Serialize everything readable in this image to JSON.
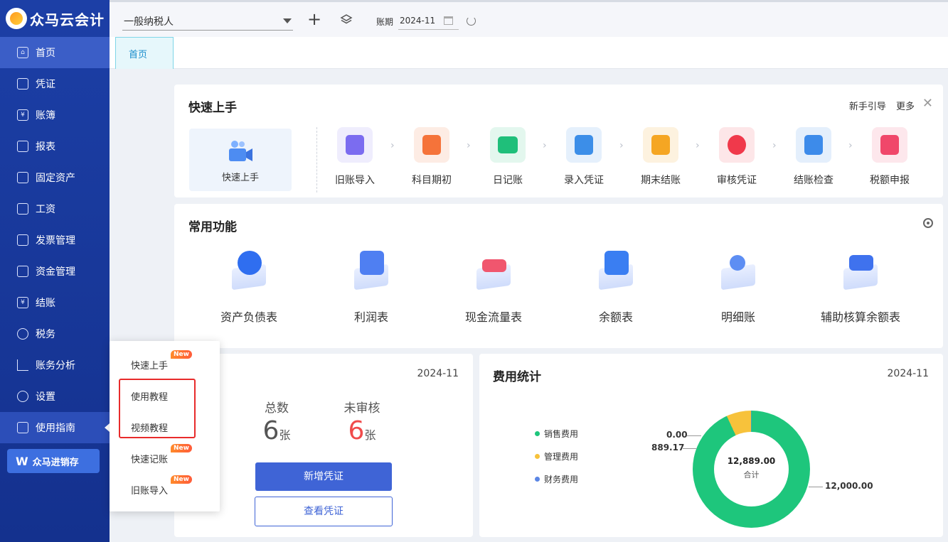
{
  "app": {
    "title": "众马云会计"
  },
  "sidebar": {
    "items": [
      {
        "label": "首页",
        "icon": "home-icon"
      },
      {
        "label": "凭证",
        "icon": "voucher-icon"
      },
      {
        "label": "账簿",
        "icon": "ledger-icon"
      },
      {
        "label": "报表",
        "icon": "report-icon"
      },
      {
        "label": "固定资产",
        "icon": "asset-icon"
      },
      {
        "label": "工资",
        "icon": "salary-icon"
      },
      {
        "label": "发票管理",
        "icon": "invoice-icon"
      },
      {
        "label": "资金管理",
        "icon": "fund-icon"
      },
      {
        "label": "结账",
        "icon": "closing-icon"
      },
      {
        "label": "税务",
        "icon": "tax-icon"
      },
      {
        "label": "账务分析",
        "icon": "analysis-icon"
      },
      {
        "label": "设置",
        "icon": "settings-icon"
      },
      {
        "label": "使用指南",
        "icon": "guide-icon"
      }
    ],
    "jxc_label": "众马进销存"
  },
  "topbar": {
    "taxpayer_type": "一般纳税人",
    "period_label": "账期",
    "period_value": "2024-11"
  },
  "tabs": [
    {
      "label": "首页"
    }
  ],
  "quick_start": {
    "title": "快速上手",
    "left_label": "快速上手",
    "links": {
      "guide": "新手引导",
      "more": "更多"
    },
    "steps": [
      {
        "label": "旧账导入",
        "color": "#7b6cf0",
        "bg": "#efedfd"
      },
      {
        "label": "科目期初",
        "color": "#f5733a",
        "bg": "#fdece4"
      },
      {
        "label": "日记账",
        "color": "#1fbf7a",
        "bg": "#e3f7ee"
      },
      {
        "label": "录入凭证",
        "color": "#3c8ee8",
        "bg": "#e5f0fc"
      },
      {
        "label": "期末结账",
        "color": "#f5a623",
        "bg": "#fdf2df"
      },
      {
        "label": "审核凭证",
        "color": "#f0394b",
        "bg": "#fde6e8"
      },
      {
        "label": "结账检查",
        "color": "#3d8bea",
        "bg": "#e4effc"
      },
      {
        "label": "税额申报",
        "color": "#f0476a",
        "bg": "#fde7ec"
      }
    ]
  },
  "common": {
    "title": "常用功能",
    "items": [
      {
        "label": "资产负债表",
        "color": "#2f6ef0"
      },
      {
        "label": "利润表",
        "color": "#4f7ff2"
      },
      {
        "label": "现金流量表",
        "color": "#f0566e"
      },
      {
        "label": "余额表",
        "color": "#3a7ef2"
      },
      {
        "label": "明细账",
        "color": "#5d8ef3"
      },
      {
        "label": "辅助核算余额表",
        "color": "#3f72ee"
      }
    ]
  },
  "voucher": {
    "date": "2024-11",
    "total_label": "总数",
    "total_value": "6",
    "unreviewed_label": "未审核",
    "unreviewed_value": "6",
    "unit": "张",
    "add_button": "新增凭证",
    "view_button": "查看凭证"
  },
  "expense": {
    "title": "费用统计",
    "date": "2024-11",
    "legend": [
      {
        "name": "销售费用",
        "color": "#1ec67c"
      },
      {
        "name": "管理费用",
        "color": "#f7c23b"
      },
      {
        "name": "财务费用",
        "color": "#5b86e5"
      }
    ],
    "total": "12,889.00",
    "total_label": "合计",
    "callouts": {
      "finance": "0.00",
      "admin": "889.17",
      "sales": "12,000.00"
    }
  },
  "chart_data": {
    "type": "pie",
    "title": "费用统计",
    "categories": [
      "销售费用",
      "管理费用",
      "财务费用"
    ],
    "values": [
      12000.0,
      889.17,
      0.0
    ],
    "legend": "left"
  },
  "popup": {
    "items": [
      {
        "label": "快速上手",
        "new": true
      },
      {
        "label": "使用教程",
        "new": false
      },
      {
        "label": "视频教程",
        "new": false
      },
      {
        "label": "快速记账",
        "new": true
      },
      {
        "label": "旧账导入",
        "new": true
      }
    ],
    "new_badge": "New"
  }
}
